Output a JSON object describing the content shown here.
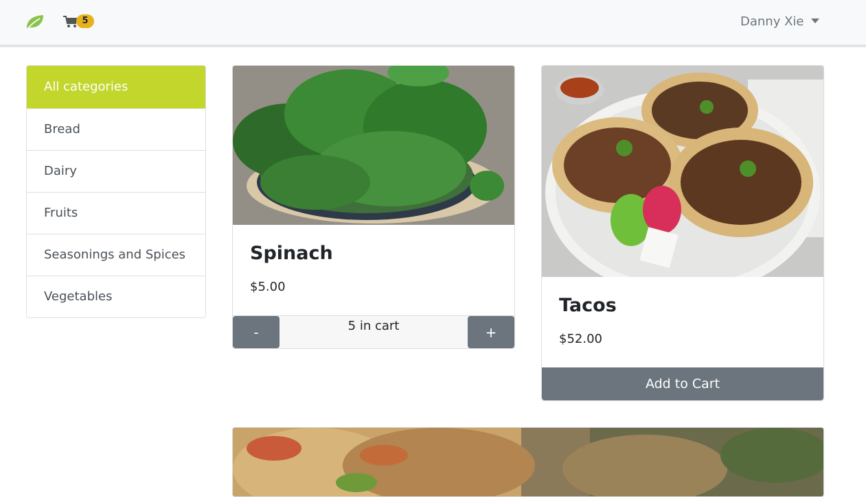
{
  "navbar": {
    "brand_icon": "leaf-icon",
    "cart_icon": "cart-icon",
    "cart_count": "5",
    "user_name": "Danny Xie",
    "colors": {
      "brand": "#8bc34a",
      "badge": "#e8b21d"
    }
  },
  "sidebar": {
    "items": [
      {
        "label": "All categories",
        "active": true
      },
      {
        "label": "Bread"
      },
      {
        "label": "Dairy"
      },
      {
        "label": "Fruits"
      },
      {
        "label": "Seasonings and Spices"
      },
      {
        "label": "Vegetables"
      }
    ],
    "active_color": "#c3d62b"
  },
  "products": [
    {
      "name": "Spinach",
      "price": "$5.00",
      "image": "spinach-photo",
      "minus_label": "-",
      "plus_label": "+",
      "cart_status": "5 in cart"
    },
    {
      "name": "Tacos",
      "price": "$52.00",
      "image": "tacos-photo",
      "button_label": "Add to Cart"
    },
    {
      "image": "pizza-photo"
    }
  ]
}
